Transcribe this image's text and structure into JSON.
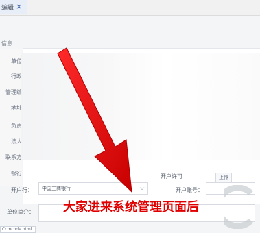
{
  "tab": {
    "label": "编辑",
    "close_icon": "×"
  },
  "page": {
    "subtitle": "信息"
  },
  "side_labels": [
    "单位",
    "行政",
    "管理编",
    "地址",
    "负责",
    "法人",
    "联系方",
    "银行"
  ],
  "form": {
    "deposit_bank_label": "开户行：",
    "deposit_bank_value": "中国工商银行",
    "account_label": "开户账号：",
    "brief_label": "单位简介：",
    "upload_label": "上传",
    "row_label_right": "开户许可"
  },
  "caption": "大家进来系统管理页面后",
  "bottom_tag": "Ccmcode.html",
  "colors": {
    "arrow": "#e60000",
    "caption": "#e00000",
    "tab_close": "#3b5fa0"
  },
  "icons": {
    "arrow": "red-arrow-icon",
    "select": "chevron-down-icon",
    "watermark": "logo-watermark-icon"
  }
}
